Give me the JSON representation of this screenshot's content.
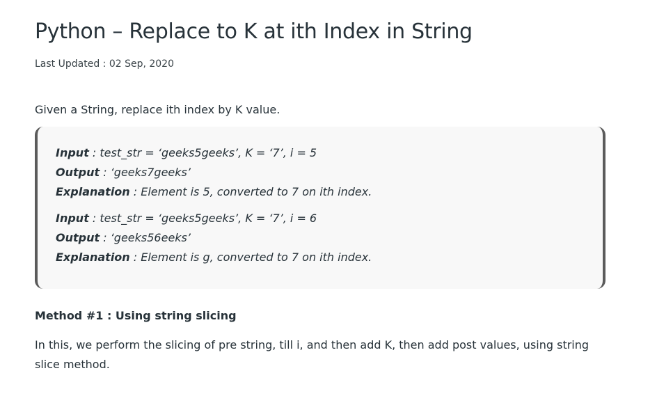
{
  "article": {
    "title": "Python – Replace to K at ith Index in String",
    "last_updated": "Last Updated : 02 Sep, 2020",
    "intro": "Given a String, replace ith index by K value.",
    "examples": [
      {
        "input_label": "Input",
        "input_value": " : test_str = ‘geeks5geeks’, K = ‘7’, i = 5",
        "output_label": "Output",
        "output_value": " : ‘geeks7geeks’",
        "explanation_label": "Explanation",
        "explanation_value": " : Element is 5, converted to 7 on ith index."
      },
      {
        "input_label": "Input",
        "input_value": " : test_str = ‘geeks5geeks’, K = ‘7’, i = 6",
        "output_label": "Output",
        "output_value": " : ‘geeks56eeks’",
        "explanation_label": "Explanation",
        "explanation_value": " : Element is g, converted to 7 on ith index."
      }
    ],
    "method_heading": "Method #1 : Using string slicing",
    "method_text": "In this, we perform the slicing of pre string, till i, and then add K, then add post values, using string slice method."
  },
  "colors": {
    "text": "#273239",
    "box_background": "#f8f8f8",
    "box_border": "#5b5b5b"
  }
}
